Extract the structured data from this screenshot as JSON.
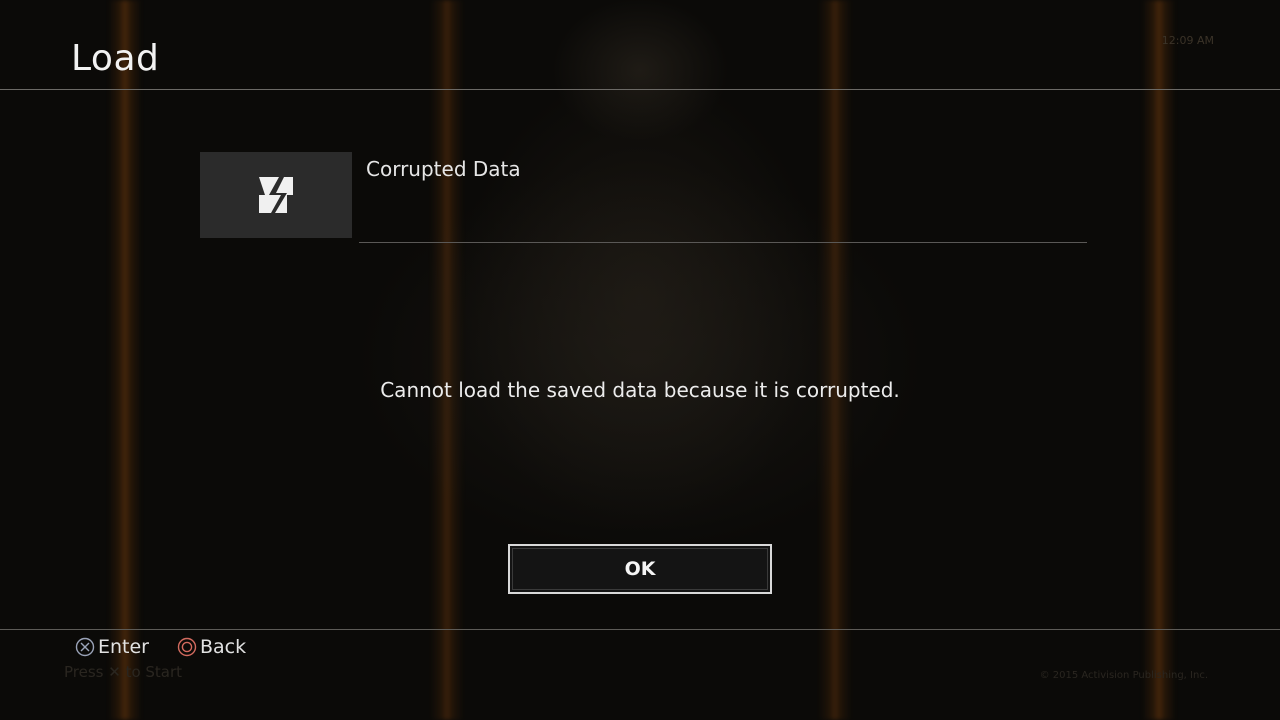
{
  "header": {
    "title": "Load",
    "top_right_text": "12:09 AM"
  },
  "save_entry": {
    "icon": "corrupted-data-icon",
    "name": "Corrupted Data"
  },
  "dialog": {
    "message": "Cannot load the saved data because it is corrupted.",
    "ok_label": "OK"
  },
  "footer": {
    "enter_icon": "cross-button-icon",
    "enter_label": "Enter",
    "back_icon": "circle-button-icon",
    "back_label": "Back",
    "background_press_start": "Press ✕ to Start",
    "background_copyright": "© 2015 Activision Publishing, Inc."
  },
  "colors": {
    "background": "#0a0907",
    "text": "#e8e8e8",
    "accent_glow": "#c86414",
    "thumb_bg": "#2b2b2b",
    "button_border": "#d9d9d9"
  }
}
